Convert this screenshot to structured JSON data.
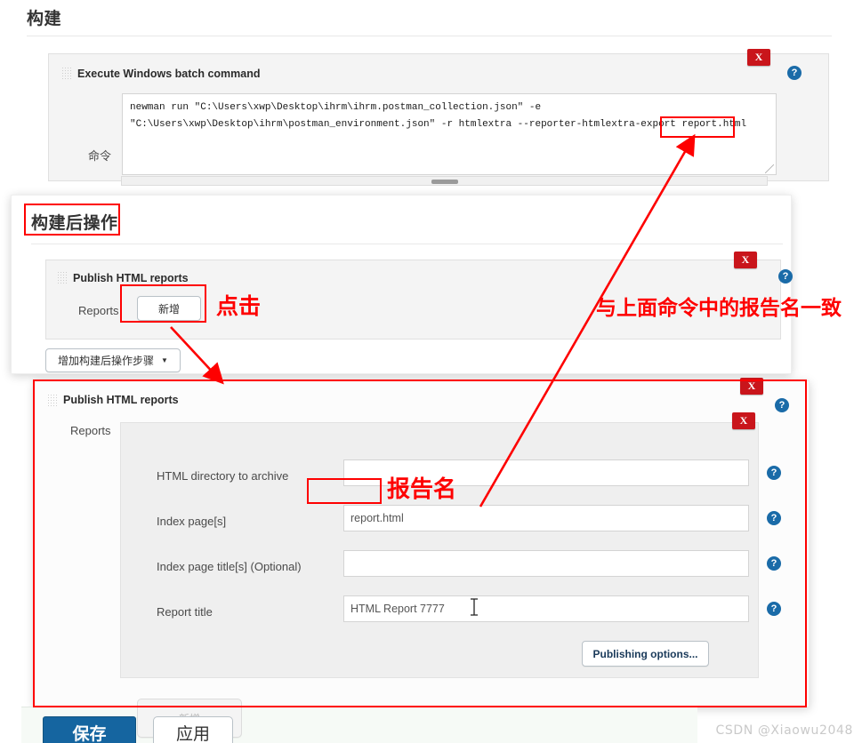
{
  "build_section": {
    "title": "构建",
    "step": {
      "heading": "Execute Windows batch command",
      "command_label": "命令",
      "command_line1_pre": "newman run \"C:\\Users\\",
      "command_line1": "newman run \"C:\\Users\\xwp\\Desktop\\ihrm\\ihrm.postman_collection.json\" -e",
      "command_line2": "\"C:\\Users\\xwp\\Desktop\\ihrm\\postman_environment.json\" -r htmlextra --reporter-htmlextra-export report.html",
      "command_line2_tail": "report.html",
      "delete_label": "X",
      "help_label": "?"
    }
  },
  "postbuild_section": {
    "title": "构建后操作",
    "step": {
      "heading": "Publish HTML reports",
      "reports_label": "Reports",
      "add_button": "新增",
      "delete_label": "X",
      "help_label": "?"
    },
    "add_step_button": "增加构建后操作步骤",
    "add_step_caret": "▼"
  },
  "expanded_panel": {
    "heading": "Publish HTML reports",
    "reports_label": "Reports",
    "delete_label": "X",
    "help_label": "?",
    "fields": [
      {
        "label": "HTML directory to archive",
        "value": "",
        "help": "?"
      },
      {
        "label": "Index page[s]",
        "value": "report.html",
        "help": "?"
      },
      {
        "label": "Index page title[s] (Optional)",
        "value": "",
        "help": "?"
      },
      {
        "label": "Report title",
        "value": "HTML Report 7777",
        "help": "?"
      }
    ],
    "publishing_options_button": "Publishing options...",
    "inner_delete_label": "X"
  },
  "footer": {
    "save_button": "保存",
    "apply_button": "应用",
    "ghost_add_button": "新增"
  },
  "annotations": {
    "click_note": "点击",
    "report_name_note": "报告名",
    "match_command_note": "与上面命令中的报告名一致"
  },
  "watermark": "CSDN @Xiaowu2048",
  "colors": {
    "annotation_red": "#fe0000",
    "delete_red": "#c9151b",
    "help_blue": "#1a6ba8",
    "primary_blue": "#1565a0"
  }
}
